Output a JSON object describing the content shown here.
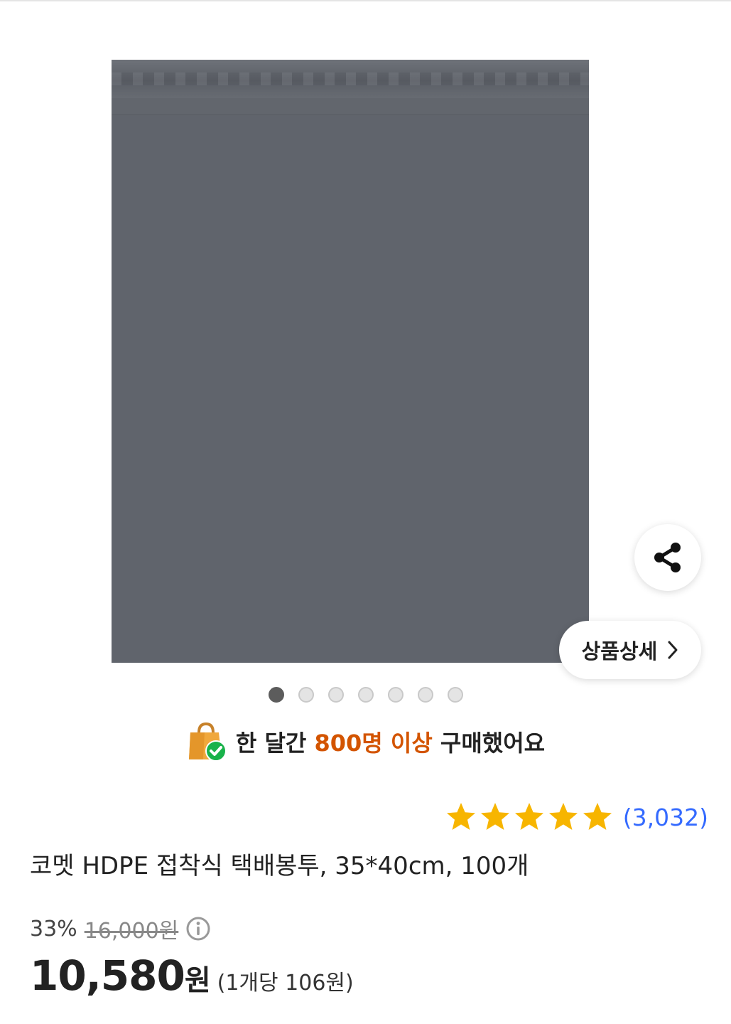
{
  "gallery": {
    "product_image_alt": "Gray HDPE adhesive delivery bag",
    "dots_total": 7,
    "active_dot": 1,
    "detail_label": "상품상세",
    "share_icon": "share-icon",
    "chevron_icon": "chevron-right-icon"
  },
  "purchase_badge": {
    "icon": "shopping-bag-check-icon",
    "prefix": "한 달간",
    "highlight": "800명 이상",
    "suffix": "구매했어요"
  },
  "rating": {
    "stars": 5,
    "star_color": "#f7b500",
    "count": "(3,032)"
  },
  "product": {
    "title": "코멧 HDPE 접착식 택배봉투, 35*40cm, 100개"
  },
  "price": {
    "discount_rate": "33%",
    "original_price": "16,000원",
    "info_icon": "info-icon",
    "sale_price": "10,580",
    "currency": "원",
    "unit_price": "(1개당 106원)"
  },
  "colors": {
    "accent_orange": "#d35400",
    "link_blue": "#346aff"
  }
}
